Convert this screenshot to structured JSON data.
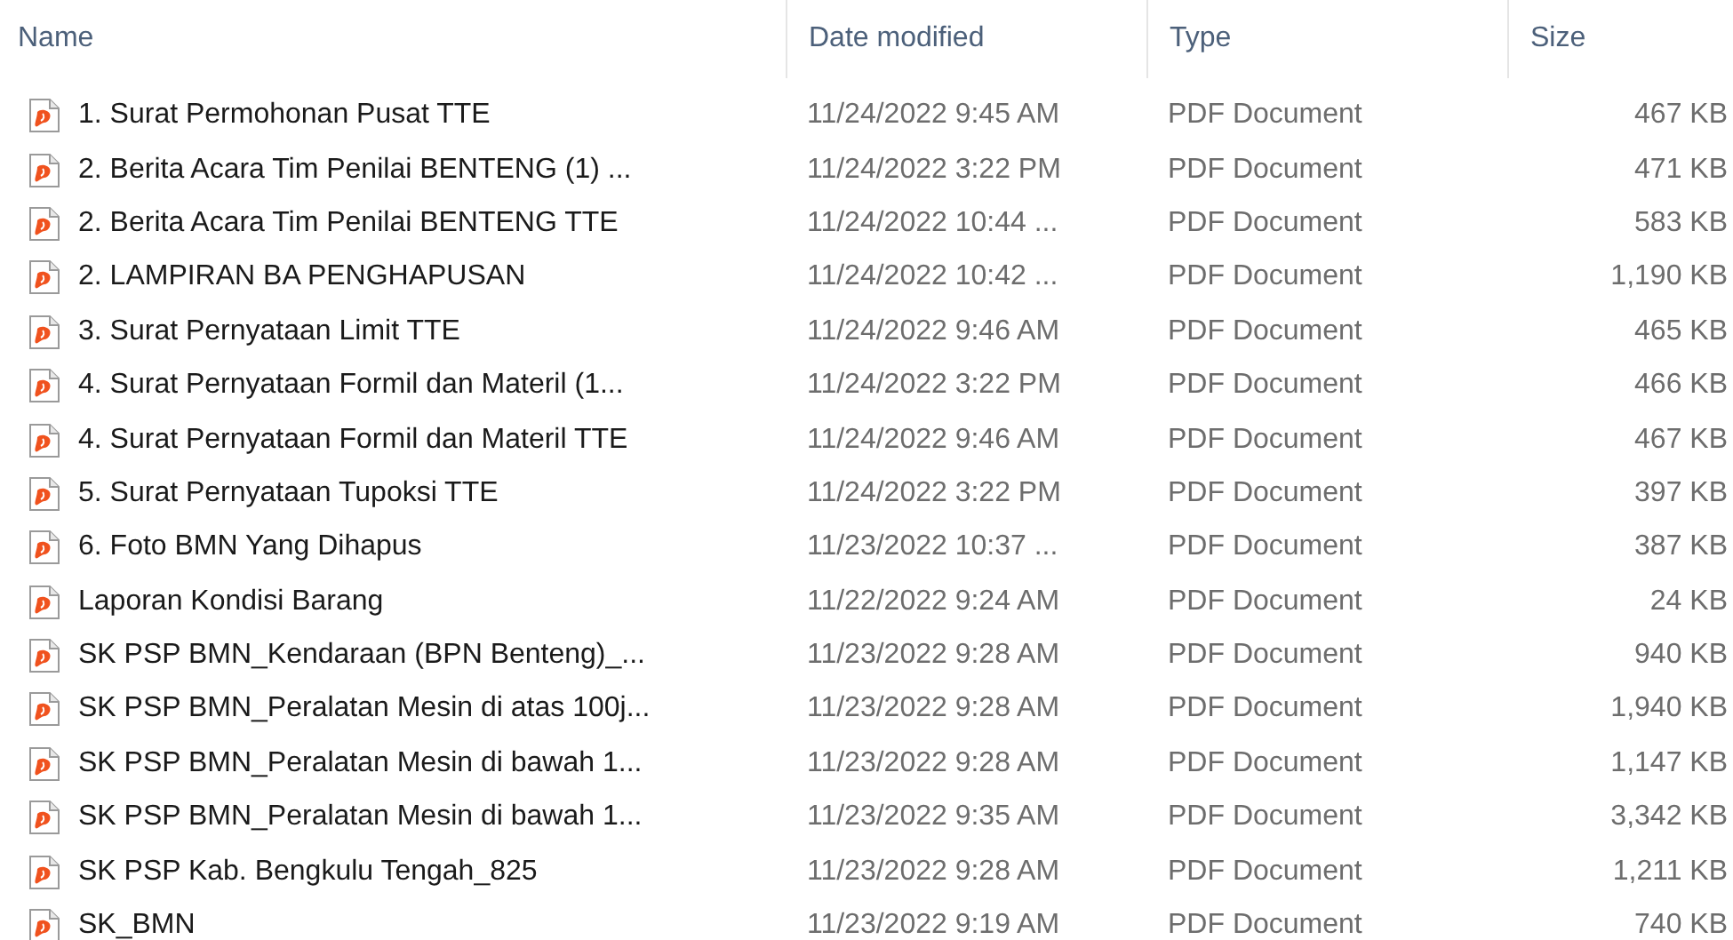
{
  "columns": [
    "Name",
    "Date modified",
    "Type",
    "Size"
  ],
  "files": [
    {
      "name": "1. Surat Permohonan Pusat TTE",
      "date": "11/24/2022 9:45 AM",
      "type": "PDF Document",
      "size": "467 KB"
    },
    {
      "name": "2. Berita Acara Tim Penilai BENTENG (1) ...",
      "date": "11/24/2022 3:22 PM",
      "type": "PDF Document",
      "size": "471 KB"
    },
    {
      "name": "2. Berita Acara Tim Penilai BENTENG TTE",
      "date": "11/24/2022 10:44 ...",
      "type": "PDF Document",
      "size": "583 KB"
    },
    {
      "name": "2. LAMPIRAN BA PENGHAPUSAN",
      "date": "11/24/2022 10:42 ...",
      "type": "PDF Document",
      "size": "1,190 KB"
    },
    {
      "name": "3. Surat Pernyataan Limit TTE",
      "date": "11/24/2022 9:46 AM",
      "type": "PDF Document",
      "size": "465 KB"
    },
    {
      "name": "4. Surat Pernyataan Formil dan Materil (1...",
      "date": "11/24/2022 3:22 PM",
      "type": "PDF Document",
      "size": "466 KB"
    },
    {
      "name": "4. Surat Pernyataan Formil dan Materil TTE",
      "date": "11/24/2022 9:46 AM",
      "type": "PDF Document",
      "size": "467 KB"
    },
    {
      "name": "5. Surat Pernyataan Tupoksi TTE",
      "date": "11/24/2022 3:22 PM",
      "type": "PDF Document",
      "size": "397 KB"
    },
    {
      "name": "6. Foto BMN Yang Dihapus",
      "date": "11/23/2022 10:37 ...",
      "type": "PDF Document",
      "size": "387 KB"
    },
    {
      "name": "Laporan Kondisi Barang",
      "date": "11/22/2022 9:24 AM",
      "type": "PDF Document",
      "size": "24 KB"
    },
    {
      "name": "SK PSP BMN_Kendaraan (BPN Benteng)_...",
      "date": "11/23/2022 9:28 AM",
      "type": "PDF Document",
      "size": "940 KB"
    },
    {
      "name": "SK PSP BMN_Peralatan Mesin di atas 100j...",
      "date": "11/23/2022 9:28 AM",
      "type": "PDF Document",
      "size": "1,940 KB"
    },
    {
      "name": "SK PSP BMN_Peralatan Mesin di bawah 1...",
      "date": "11/23/2022 9:28 AM",
      "type": "PDF Document",
      "size": "1,147 KB"
    },
    {
      "name": "SK PSP BMN_Peralatan Mesin di bawah 1...",
      "date": "11/23/2022 9:35 AM",
      "type": "PDF Document",
      "size": "3,342 KB"
    },
    {
      "name": "SK PSP Kab. Bengkulu Tengah_825",
      "date": "11/23/2022 9:28 AM",
      "type": "PDF Document",
      "size": "1,211 KB"
    },
    {
      "name": "SK_BMN",
      "date": "11/23/2022 9:19 AM",
      "type": "PDF Document",
      "size": "740 KB"
    }
  ]
}
